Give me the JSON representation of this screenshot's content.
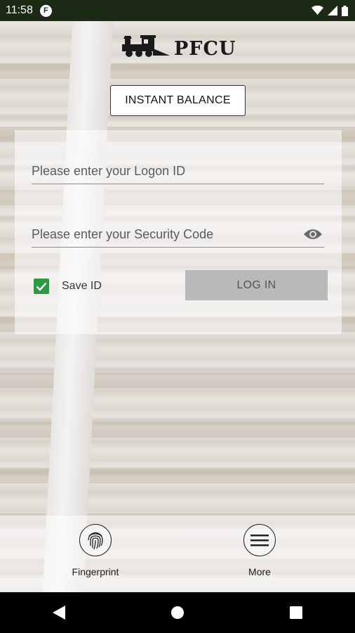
{
  "status_bar": {
    "time": "11:58",
    "app_badge": "F"
  },
  "logo": {
    "text": "PFCU"
  },
  "instant_balance": {
    "label": "INSTANT BALANCE"
  },
  "login_form": {
    "logon_placeholder": "Please enter your Logon ID",
    "security_placeholder": "Please enter your Security Code",
    "save_id_label": "Save ID",
    "save_id_checked": true,
    "login_label": "LOG IN"
  },
  "bottom_actions": {
    "fingerprint_label": "Fingerprint",
    "more_label": "More"
  },
  "colors": {
    "status_bar_bg": "#1b2a14",
    "checkbox_green": "#2f9a44",
    "login_button_bg": "#b9b9b9"
  },
  "icons": [
    "status-app-icon",
    "wifi-icon",
    "signal-icon",
    "battery-icon",
    "locomotive-icon",
    "eye-icon",
    "check-icon",
    "fingerprint-icon",
    "menu-icon",
    "back-icon",
    "home-icon",
    "recents-icon"
  ]
}
